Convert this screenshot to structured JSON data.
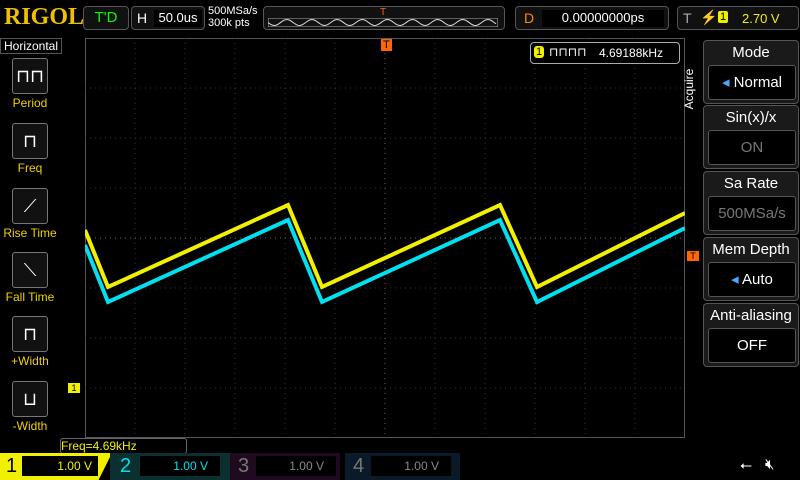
{
  "header": {
    "brand": "RIGOL",
    "run_status": "T'D",
    "horizontal_label": "H",
    "timebase": "50.0us",
    "sample_rate": "500MSa/s",
    "memory_depth": "300k pts",
    "delay_label": "D",
    "delay": "0.00000000ps",
    "trigger_label": "T",
    "trigger_source": "1",
    "trigger_level": "2.70 V"
  },
  "left_panel": {
    "title": "Horizontal",
    "items": [
      {
        "label": "Period"
      },
      {
        "label": "Freq"
      },
      {
        "label": "Rise Time"
      },
      {
        "label": "Fall Time"
      },
      {
        "label": "+Width"
      },
      {
        "label": "-Width"
      }
    ]
  },
  "right_panel": {
    "section": "Acquire",
    "items": [
      {
        "title": "Mode",
        "value": "Normal"
      },
      {
        "title": "Sin(x)/x",
        "value": "ON"
      },
      {
        "title": "Sa Rate",
        "value": "500MSa/s"
      },
      {
        "title": "Mem Depth",
        "value": "Auto"
      },
      {
        "title": "Anti-aliasing",
        "value": "OFF"
      }
    ]
  },
  "counter": {
    "channel": "1",
    "value": "4.69188kHz"
  },
  "measurement": "Freq=4.69kHz",
  "channels": [
    {
      "num": "1",
      "scale": "1.00 V",
      "color": "#f0f000"
    },
    {
      "num": "2",
      "scale": "1.00 V",
      "color": "#00e0f0"
    },
    {
      "num": "3",
      "scale": "1.00 V",
      "color": "#888"
    },
    {
      "num": "4",
      "scale": "1.00 V",
      "color": "#888"
    }
  ],
  "markers": {
    "trigger": "T",
    "ch1": "1"
  }
}
